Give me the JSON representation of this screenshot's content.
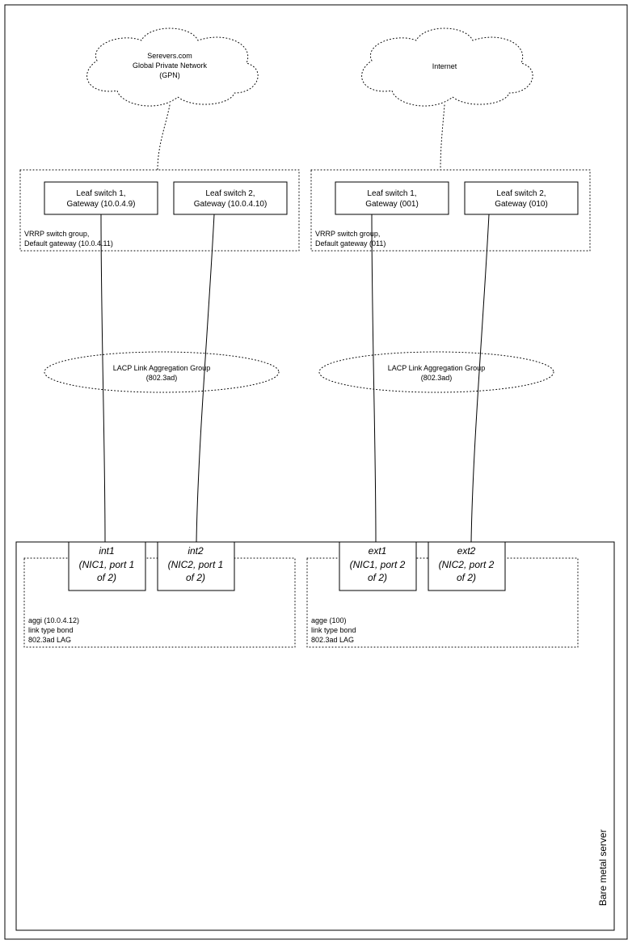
{
  "clouds": {
    "left": {
      "line1": "Serevers.com",
      "line2": "Global Private Network",
      "line3": "(GPN)"
    },
    "right": {
      "line1": "Internet"
    }
  },
  "vrrp": {
    "left": {
      "switch1": {
        "line1": "Leaf switch 1,",
        "line2": "Gateway (10.0.4.9)"
      },
      "switch2": {
        "line1": "Leaf switch 2,",
        "line2": "Gateway (10.0.4.10)"
      },
      "group_line1": "VRRP switch group,",
      "group_line2": "Default gateway (10.0.4.11)"
    },
    "right": {
      "switch1": {
        "line1": "Leaf switch 1,",
        "line2": "Gateway (001)"
      },
      "switch2": {
        "line1": "Leaf switch 2,",
        "line2": "Gateway (010)"
      },
      "group_line1": "VRRP switch group,",
      "group_line2": "Default gateway (011)"
    }
  },
  "lacp": {
    "left": {
      "line1": "LACP Link Aggregation Group",
      "line2": "(802.3ad)"
    },
    "right": {
      "line1": "LACP Link Aggregation Group",
      "line2": "(802.3ad)"
    }
  },
  "nics": {
    "int1": {
      "name": "int1",
      "desc1": "(NIC1, port 1",
      "desc2": "of 2)"
    },
    "int2": {
      "name": "int2",
      "desc1": "(NIC2, port 1",
      "desc2": "of 2)"
    },
    "ext1": {
      "name": "ext1",
      "desc1": "(NIC1, port 2",
      "desc2": "of 2)"
    },
    "ext2": {
      "name": "ext2",
      "desc1": "(NIC2, port 2",
      "desc2": "of 2)"
    }
  },
  "aggs": {
    "left": {
      "line1": "aggi (10.0.4.12)",
      "line2": "link type bond",
      "line3": "802.3ad LAG"
    },
    "right": {
      "line1": "agge (100)",
      "line2": "link type bond",
      "line3": "802.3ad LAG"
    }
  },
  "server_label": "Bare metal server"
}
